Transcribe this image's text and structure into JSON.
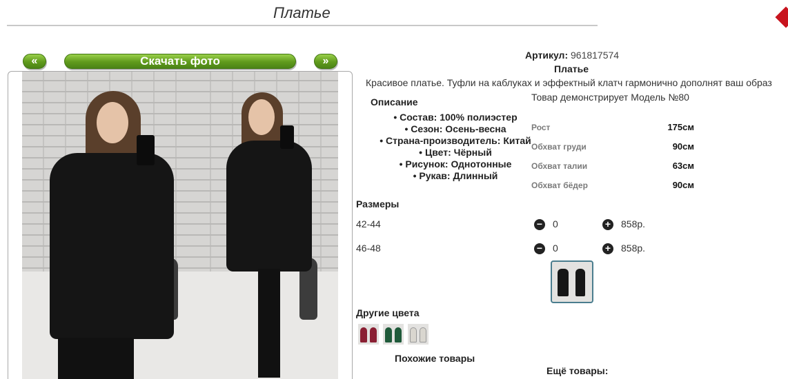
{
  "page": {
    "title": "Платье"
  },
  "gallery": {
    "prev_label": "«",
    "download_label": "Скачать фото",
    "next_label": "»"
  },
  "product": {
    "article_label": "Артикул:",
    "article_value": "961817574",
    "name": "Платье",
    "description": "Красивое платье. Туфли на каблуках и эффектный клатч гармонично дополнят ваш образ",
    "model_note": "Товар демонстрирует Модель №80"
  },
  "description": {
    "heading": "Описание",
    "attributes": [
      "Состав: 100% полиэстер",
      "Сезон: Осень-весна",
      "Страна-производитель: Китай",
      "Цвет: Чёрный",
      "Рисунок: Однотонные",
      "Рукав: Длинный"
    ]
  },
  "measurements": [
    {
      "label": "Рост",
      "value": "175см"
    },
    {
      "label": "Обхват груди",
      "value": "90см"
    },
    {
      "label": "Обхват талии",
      "value": "63см"
    },
    {
      "label": "Обхват бёдер",
      "value": "90см"
    }
  ],
  "sizes": {
    "heading": "Размеры",
    "rows": [
      {
        "size": "42-44",
        "minus": "−",
        "qty": "0",
        "plus": "+",
        "price": "858р."
      },
      {
        "size": "46-48",
        "minus": "−",
        "qty": "0",
        "plus": "+",
        "price": "858р."
      }
    ]
  },
  "other_colors": {
    "heading": "Другие цвета",
    "swatches": [
      "#8a1f33",
      "#1f5a3a",
      "#d9d6cf"
    ]
  },
  "similar": {
    "heading": "Похожие товары"
  },
  "more": {
    "heading": "Ещё товары:"
  },
  "colors": {
    "accent": "#5f9a1c",
    "brand_mark": "#c8141e"
  }
}
